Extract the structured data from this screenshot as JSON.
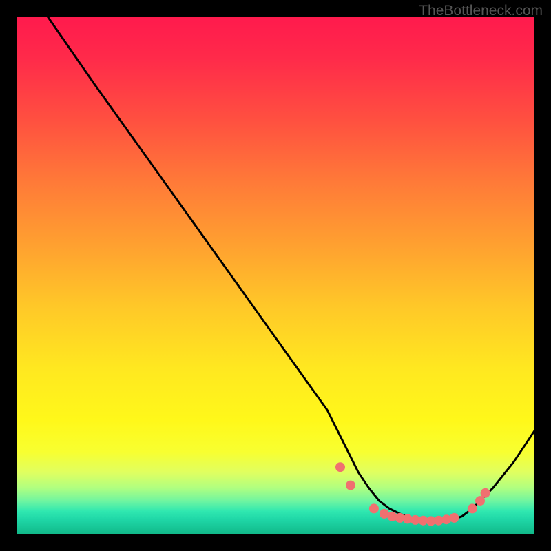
{
  "watermark": "TheBottleneck.com",
  "chart_data": {
    "type": "line",
    "title": "",
    "xlabel": "",
    "ylabel": "",
    "xlim": [
      0,
      100
    ],
    "ylim": [
      0,
      100
    ],
    "series": [
      {
        "name": "curve",
        "x": [
          6,
          15,
          25,
          35,
          45,
          55,
          60,
          62,
          64,
          66,
          68,
          70,
          72,
          74,
          76,
          78,
          80,
          82,
          84,
          86,
          88,
          92,
          96,
          100
        ],
        "y": [
          100,
          87,
          73,
          59,
          45,
          31,
          24,
          20,
          16,
          12,
          9,
          6.5,
          5,
          4,
          3.2,
          2.8,
          2.6,
          2.6,
          2.8,
          3.5,
          5,
          9,
          14,
          20
        ]
      }
    ],
    "markers": [
      {
        "x": 62.5,
        "y": 13
      },
      {
        "x": 64.5,
        "y": 9.5
      },
      {
        "x": 69,
        "y": 5
      },
      {
        "x": 71,
        "y": 4
      },
      {
        "x": 72.5,
        "y": 3.5
      },
      {
        "x": 74,
        "y": 3.2
      },
      {
        "x": 75.5,
        "y": 3
      },
      {
        "x": 77,
        "y": 2.8
      },
      {
        "x": 78.5,
        "y": 2.7
      },
      {
        "x": 80,
        "y": 2.6
      },
      {
        "x": 81.5,
        "y": 2.7
      },
      {
        "x": 83,
        "y": 2.9
      },
      {
        "x": 84.5,
        "y": 3.2
      },
      {
        "x": 88,
        "y": 5
      },
      {
        "x": 89.5,
        "y": 6.5
      },
      {
        "x": 90.5,
        "y": 8
      }
    ],
    "marker_color": "#f07070",
    "line_color": "#000000",
    "background": "gradient-red-yellow-green"
  }
}
